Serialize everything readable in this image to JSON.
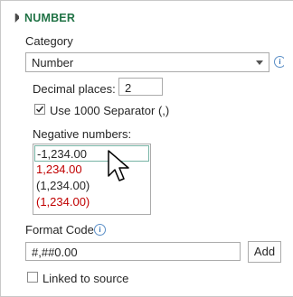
{
  "section": {
    "title": "NUMBER",
    "icon": "triangle-down-icon"
  },
  "category": {
    "label": "Category",
    "underline": "C",
    "value": "Number",
    "options_visible": [
      "Number"
    ]
  },
  "decimal_places": {
    "label": "Decimal places:",
    "value": "2"
  },
  "separator": {
    "label": "Use 1000 Separator (,)",
    "checked": true
  },
  "negative_numbers": {
    "label": "Negative numbers:",
    "items": [
      {
        "text": "-1,234.00",
        "color": "#262626",
        "selected": true
      },
      {
        "text": "1,234.00",
        "color": "#c00000",
        "selected": false
      },
      {
        "text": "(1,234.00)",
        "color": "#262626",
        "selected": false
      },
      {
        "text": "(1,234.00)",
        "color": "#c00000",
        "selected": false
      }
    ]
  },
  "format_code": {
    "label": "Format Code",
    "value": "#,##0.00",
    "add_label": "Add"
  },
  "linked_to_source": {
    "label": "Linked to source",
    "checked": false
  },
  "colors": {
    "accent": "#217346",
    "negative_red": "#c00000",
    "info_blue": "#2f6fb3"
  }
}
